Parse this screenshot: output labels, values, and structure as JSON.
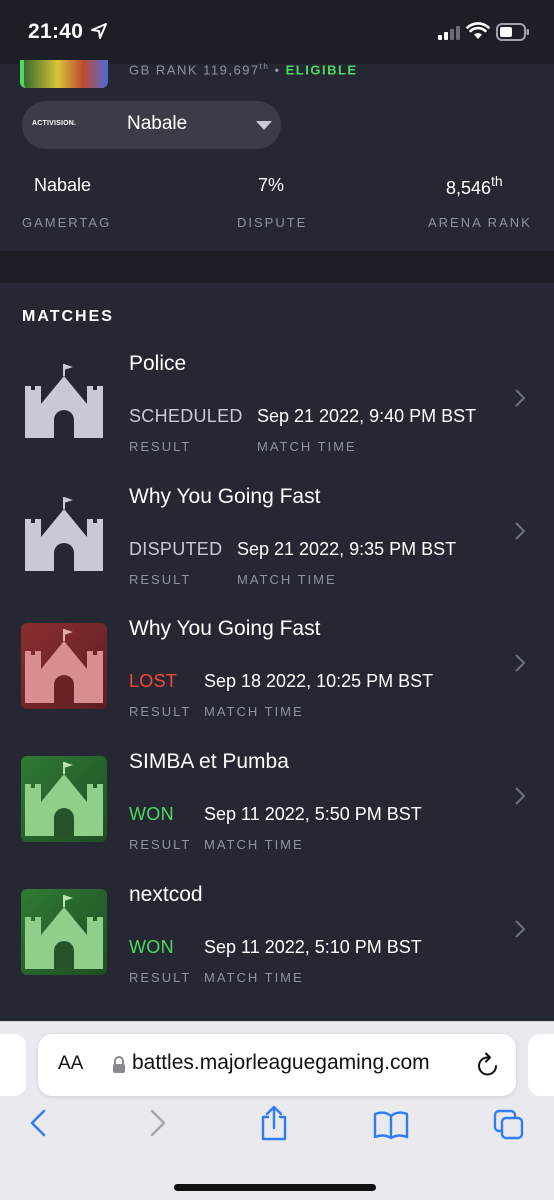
{
  "status_bar": {
    "time": "21:40"
  },
  "profile": {
    "rank_text": "GB RANK 119,697",
    "rank_suffix": "th",
    "separator": "•",
    "eligible": "ELIGIBLE",
    "platform_logo": "ACTIVISION.",
    "platform_name": "Nabale",
    "stats": [
      {
        "value": "Nabale",
        "label": "GAMERTAG"
      },
      {
        "value": "7%",
        "label": "DISPUTE"
      },
      {
        "value": "8,546",
        "suffix": "th",
        "label": "ARENA RANK"
      }
    ]
  },
  "matches": {
    "title": "MATCHES",
    "result_label": "RESULT",
    "time_label": "MATCH TIME",
    "items": [
      {
        "title": "Police",
        "result": "SCHEDULED",
        "time": "Sep 21 2022, 9:40 PM BST",
        "status": "neutral"
      },
      {
        "title": "Why You Going Fast",
        "result": "DISPUTED",
        "time": "Sep 21 2022, 9:35 PM BST",
        "status": "neutral"
      },
      {
        "title": "Why You Going Fast",
        "result": "LOST",
        "time": "Sep 18 2022, 10:25 PM BST",
        "status": "lost"
      },
      {
        "title": "SIMBA et Pumba",
        "result": "WON",
        "time": "Sep 11 2022, 5:50 PM BST",
        "status": "won"
      },
      {
        "title": "nextcod",
        "result": "WON",
        "time": "Sep 11 2022, 5:10 PM BST",
        "status": "won"
      }
    ]
  },
  "browser": {
    "aa_label": "AA",
    "url": "battles.majorleaguegaming.com"
  },
  "colors": {
    "won": "#4cd964",
    "lost": "#ff453a",
    "neutral": "#c7cad4",
    "safari_blue": "#2f7cf6"
  }
}
